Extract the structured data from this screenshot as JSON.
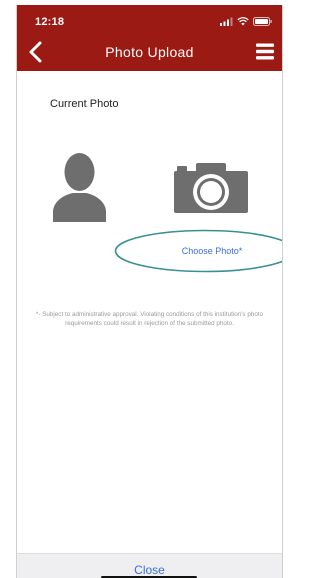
{
  "status_bar": {
    "time": "12:18",
    "signal_icon": "cellular-signal-icon",
    "wifi_icon": "wifi-icon",
    "battery_icon": "battery-icon"
  },
  "nav": {
    "title": "Photo Upload",
    "back_icon": "chevron-left-icon",
    "menu_icon": "hamburger-menu-icon"
  },
  "content": {
    "current_photo_label": "Current Photo",
    "avatar_icon": "person-silhouette-icon",
    "camera_icon": "camera-icon",
    "choose_photo_label": "Choose Photo*",
    "disclaimer": "*- Subject to administrative approval. Violating conditions of this institution's photo requirements could result in rejection of the submitted photo."
  },
  "footer": {
    "close_label": "Close"
  },
  "colors": {
    "header": "#9b1b14",
    "link": "#3a6fd8",
    "annotation_oval": "#3a8f8f",
    "icon_gray": "#6e6e6e"
  }
}
